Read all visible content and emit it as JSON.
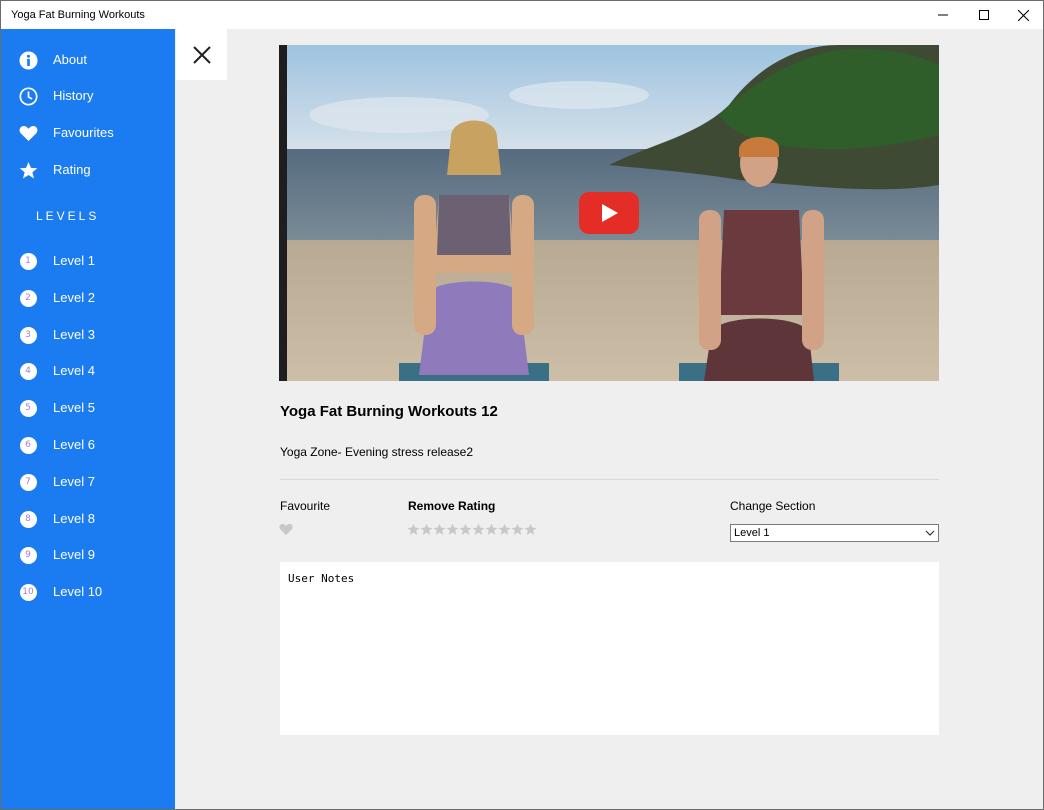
{
  "window": {
    "title": "Yoga Fat Burning Workouts",
    "icons": [
      "minimize-icon",
      "maximize-icon",
      "close-icon"
    ]
  },
  "sidebar": {
    "background": "#1b7bf0",
    "items": [
      {
        "label": "About",
        "icon": "info-icon"
      },
      {
        "label": "History",
        "icon": "clock-icon"
      },
      {
        "label": "Favourites",
        "icon": "heart-icon"
      },
      {
        "label": "Rating",
        "icon": "star-icon"
      }
    ],
    "levels_heading": "LEVELS",
    "levels": [
      {
        "number": "1",
        "label": "Level 1"
      },
      {
        "number": "2",
        "label": "Level 2"
      },
      {
        "number": "3",
        "label": "Level 3"
      },
      {
        "number": "4",
        "label": "Level 4"
      },
      {
        "number": "5",
        "label": "Level 5"
      },
      {
        "number": "6",
        "label": "Level 6"
      },
      {
        "number": "7",
        "label": "Level 7"
      },
      {
        "number": "8",
        "label": "Level 8"
      },
      {
        "number": "9",
        "label": "Level 9"
      },
      {
        "number": "10",
        "label": "Level 10"
      }
    ]
  },
  "main": {
    "video": {
      "play_icon": "youtube-play-icon",
      "play_color": "#e52d27"
    },
    "title": "Yoga Fat Burning Workouts 12",
    "description": "Yoga Zone- Evening stress release2",
    "favourite_label": "Favourite",
    "remove_rating_label": "Remove Rating",
    "rating": {
      "max": 10,
      "value": 0
    },
    "change_section_label": "Change Section",
    "section_selected": "Level 1",
    "notes_placeholder": "User Notes"
  }
}
